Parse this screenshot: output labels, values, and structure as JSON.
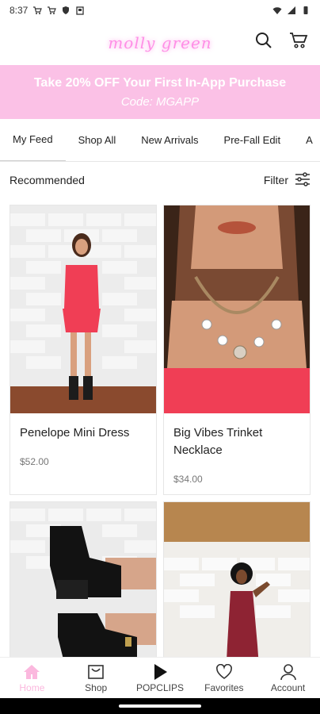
{
  "status_bar": {
    "time": "8:37"
  },
  "header": {
    "logo_text": "molly green"
  },
  "promo": {
    "title": "Take 20% OFF Your First In-App Purchase",
    "code": "Code: MGAPP",
    "bg_color": "#fbc1e6"
  },
  "tabs": [
    "My Feed",
    "Shop All",
    "New Arrivals",
    "Pre-Fall Edit",
    "A"
  ],
  "section": {
    "title": "Recommended",
    "filter_label": "Filter"
  },
  "products": [
    {
      "name": "Penelope Mini Dress",
      "price": "$52.00"
    },
    {
      "name": "Big Vibes Trinket Necklace",
      "price": "$34.00"
    },
    {
      "name": "",
      "price": ""
    },
    {
      "name": "",
      "price": ""
    }
  ],
  "bottom_nav": {
    "items": [
      {
        "label": "Home"
      },
      {
        "label": "Shop"
      },
      {
        "label": "POPCLIPS"
      },
      {
        "label": "Favorites"
      },
      {
        "label": "Account"
      }
    ],
    "active_color": "#fbb8de"
  },
  "icons": {
    "search": "search-icon",
    "cart": "cart-icon",
    "filter": "sliders-icon"
  }
}
